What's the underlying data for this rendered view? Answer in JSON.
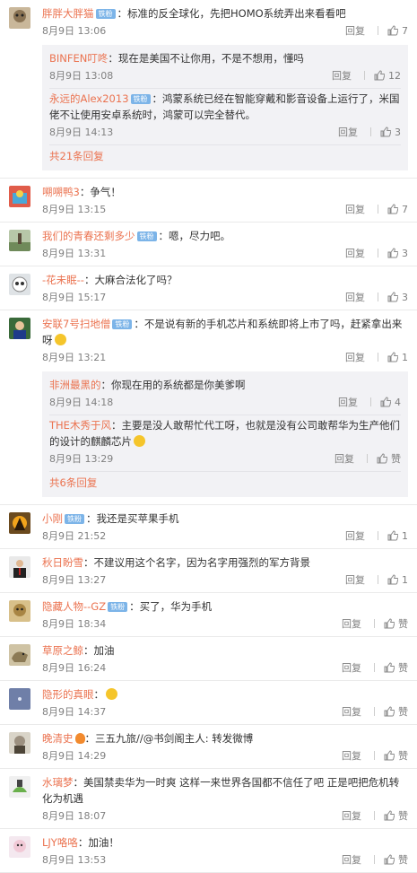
{
  "labels": {
    "reply": "回复",
    "like": "赞",
    "vip": "铁粉"
  },
  "comments": [
    {
      "user": "胖胖大胖猫",
      "vip": true,
      "text": "：标准的反全球化，先把HOMO系统弄出来看看吧",
      "time": "8月9日 13:06",
      "likes": "7",
      "replies": [
        {
          "user": "BINFEN叮咚",
          "vip": false,
          "text": "：现在是美国不让你用，不是不想用，懂吗",
          "time": "8月9日 13:08",
          "likes": "12"
        },
        {
          "user": "永远的Alex2013",
          "vip": true,
          "text": "：鸿蒙系统已经在智能穿戴和影音设备上运行了，米国佬不让使用安卓系统时，鸿蒙可以完全替代。",
          "time": "8月9日 14:13",
          "likes": "3"
        }
      ],
      "more": "共21条回复"
    },
    {
      "user": "嗍嗍鸭3",
      "vip": false,
      "text": "：争气！",
      "time": "8月9日 13:15",
      "likes": "7"
    },
    {
      "user": "我们的青春还剩多少",
      "vip": true,
      "text": "：嗯，尽力吧。",
      "time": "8月9日 13:31",
      "likes": "3"
    },
    {
      "user": "-花未眠--",
      "vip": false,
      "text": "：大麻合法化了吗？",
      "time": "8月9日 15:17",
      "likes": "3"
    },
    {
      "user": "安联7号扫地僧",
      "vip": true,
      "text": "：不是说有新的手机芯片和系统即将上市了吗，赶紧拿出来呀",
      "time": "8月9日 13:21",
      "likes": "1",
      "replies": [
        {
          "user": "非洲最黑的",
          "vip": false,
          "text": "：你现在用的系统都是你美爹啊",
          "time": "8月9日 14:18",
          "likes": "4"
        },
        {
          "user": "THE木秀于风",
          "vip": false,
          "text": "：主要是没人敢帮忙代工呀，也就是没有公司敢帮华为生产他们的设计的麒麟芯片",
          "time": "8月9日 13:29",
          "likes": "赞"
        }
      ],
      "more": "共6条回复"
    },
    {
      "user": "小刚",
      "vip": true,
      "text": "：我还是买苹果手机",
      "time": "8月9日 21:52",
      "likes": "1"
    },
    {
      "user": "秋日盼雪",
      "vip": false,
      "text": "：不建议用这个名字，因为名字用强烈的军方背景",
      "time": "8月9日 13:27",
      "likes": "1"
    },
    {
      "user": "隐藏人物--GZ",
      "vip": true,
      "text": "：买了，华为手机",
      "time": "8月9日 18:34",
      "likes": "赞"
    },
    {
      "user": "草原之鲸",
      "vip": false,
      "text": "：加油",
      "time": "8月9日 16:24",
      "likes": "赞"
    },
    {
      "user": "隐形的真眼",
      "vip": false,
      "text": "：",
      "time": "8月9日 14:37",
      "likes": "赞"
    },
    {
      "user": "晚清史",
      "vip": false,
      "text": "：三五九旅//@书剑阁主人: 转发微博",
      "time": "8月9日 14:29",
      "likes": "赞"
    },
    {
      "user": "水璃梦",
      "vip": false,
      "text": "：美国禁卖华为一时爽 这样一来世界各国都不信任了吧 正是吧把危机转化为机遇",
      "time": "8月9日 18:07",
      "likes": "赞"
    },
    {
      "user": "LJY咯咯",
      "vip": false,
      "text": "：加油！",
      "time": "8月9日 13:53",
      "likes": "赞"
    }
  ]
}
